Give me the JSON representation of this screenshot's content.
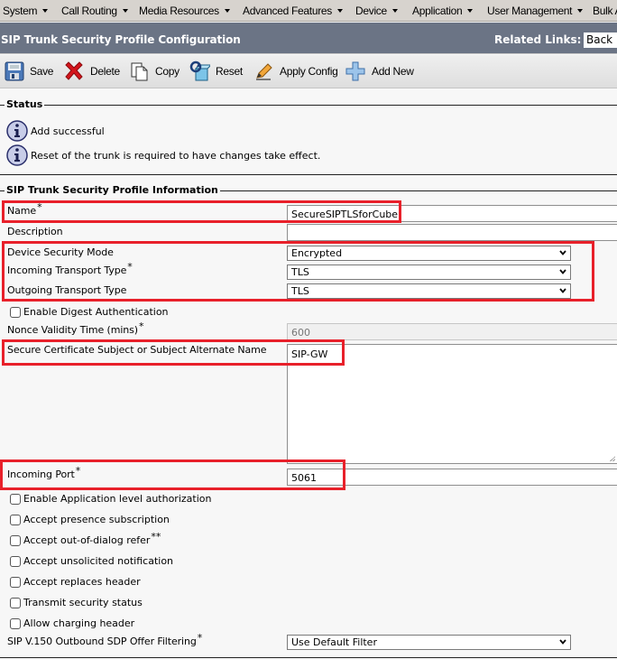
{
  "menubar": {
    "items": [
      {
        "label": "System"
      },
      {
        "label": "Call Routing"
      },
      {
        "label": "Media Resources"
      },
      {
        "label": "Advanced Features"
      },
      {
        "label": "Device"
      },
      {
        "label": "Application"
      },
      {
        "label": "User Management"
      },
      {
        "label": "Bulk A"
      }
    ]
  },
  "header": {
    "title": "SIP Trunk Security Profile Configuration",
    "related_links_label": "Related Links:",
    "related_links_value": "Back"
  },
  "toolbar": {
    "save_label": "Save",
    "delete_label": "Delete",
    "copy_label": "Copy",
    "reset_label": "Reset",
    "apply_config_label": "Apply Config",
    "add_new_label": "Add New"
  },
  "status": {
    "legend": "Status",
    "messages": [
      {
        "icon": "info-icon",
        "text": "Add successful"
      },
      {
        "icon": "info-icon",
        "text": "Reset of the trunk is required to have changes take effect."
      }
    ]
  },
  "profile": {
    "legend": "SIP Trunk Security Profile Information",
    "required_marker": "*",
    "double_marker": "**",
    "name": {
      "label": "Name",
      "value": "SecureSIPTLSforCube"
    },
    "description": {
      "label": "Description",
      "value": ""
    },
    "device_security_mode": {
      "label": "Device Security Mode",
      "value": "Encrypted"
    },
    "incoming_transport_type": {
      "label": "Incoming Transport Type",
      "value": "TLS"
    },
    "outgoing_transport_type": {
      "label": "Outgoing Transport Type",
      "value": "TLS"
    },
    "enable_digest_authentication": {
      "label": "Enable Digest Authentication",
      "checked": false
    },
    "nonce_validity_time": {
      "label": "Nonce Validity Time (mins)",
      "value": "600"
    },
    "secure_certificate_subject": {
      "label": "Secure Certificate Subject or Subject Alternate Name",
      "value": "SIP-GW"
    },
    "incoming_port": {
      "label": "Incoming Port",
      "value": "5061"
    },
    "checkboxes": [
      {
        "label": "Enable Application level authorization",
        "checked": false
      },
      {
        "label": "Accept presence subscription",
        "checked": false
      },
      {
        "label": "Accept out-of-dialog refer",
        "checked": false
      },
      {
        "label": "Accept unsolicited notification",
        "checked": false
      },
      {
        "label": "Accept replaces header",
        "checked": false
      },
      {
        "label": "Transmit security status",
        "checked": false
      },
      {
        "label": "Allow charging header",
        "checked": false
      }
    ],
    "sdp_offer_filtering": {
      "label": "SIP V.150 Outbound SDP Offer Filtering",
      "value": "Use Default Filter"
    }
  },
  "colors": {
    "menubar_bg": "#d7d3ce",
    "titlebar_bg": "#6b7485",
    "highlight_red": "#e8202a"
  }
}
